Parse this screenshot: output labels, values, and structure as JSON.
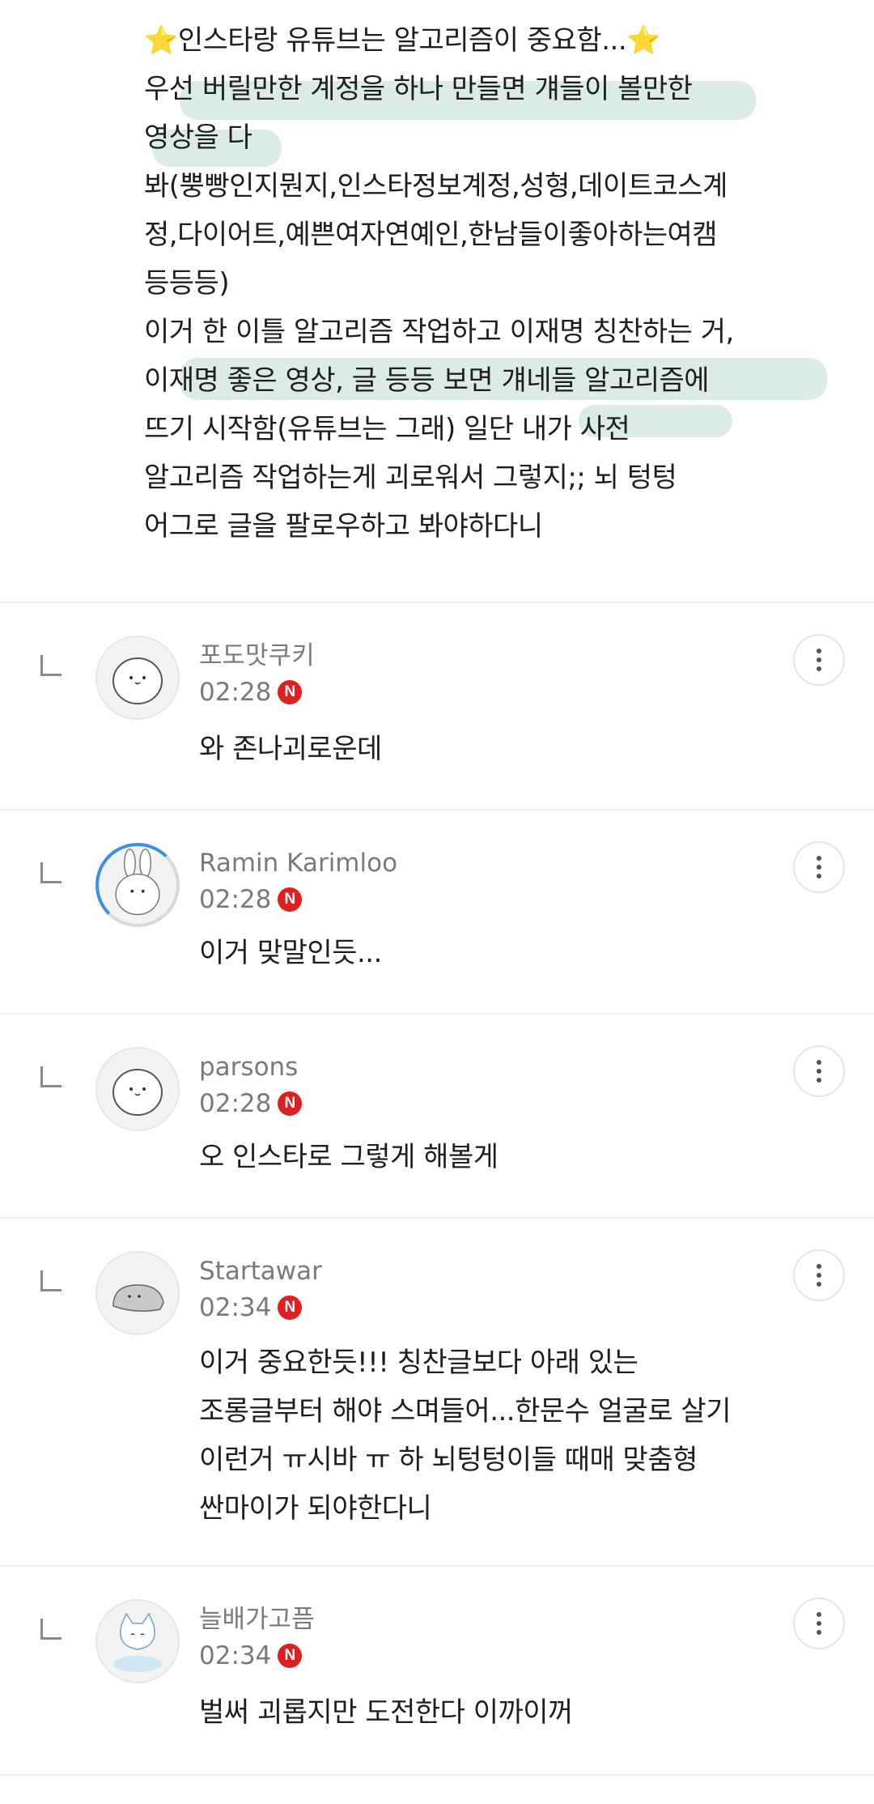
{
  "post": {
    "lines": [
      "⭐인스타랑 유튜브는 알고리즘이 중요함...⭐",
      "우선 버릴만한 계정을 하나 만들면 걔들이 볼만한",
      "영상을 다",
      "봐(뿡빵인지뭔지,인스타정보계정,성형,데이트코스계",
      "정,다이어트,예쁜여자연예인,한남들이좋아하는여캠",
      "등등등)",
      "",
      "이거 한 이틀 알고리즘 작업하고 이재명 칭찬하는 거,",
      "이재명 좋은 영상, 글 등등 보면 걔네들 알고리즘에",
      "뜨기 시작함(유튜브는 그래) 일단 내가 사전",
      "알고리즘 작업하는게 괴로워서 그렇지;; 뇌 텅텅",
      "어그로 글을 팔로우하고 봐야하다니"
    ]
  },
  "comments": [
    {
      "author": "포도맛쿠키",
      "time": "02:28",
      "badge": "N",
      "text": "와 존나괴로운데",
      "avatar_icon": "blob-avatar-icon"
    },
    {
      "author": "Ramin Karimloo",
      "time": "02:28",
      "badge": "N",
      "text": "이거 맞말인듯...",
      "avatar_icon": "bunny-avatar-icon"
    },
    {
      "author": "parsons",
      "time": "02:28",
      "badge": "N",
      "text": "오 인스타로 그렇게 해볼게",
      "avatar_icon": "blob-avatar-icon"
    },
    {
      "author": "Startawar",
      "time": "02:34",
      "badge": "N",
      "text": "이거 중요한듯!!! 칭찬글보다 아래 있는\n조롱글부터 해야 스며들어...한문수 얼굴로 살기\n이런거 ㅠ시바 ㅠ 하 뇌텅텅이들 때매 맞춤형\n싼마이가 되야한다니",
      "avatar_icon": "dino-avatar-icon"
    },
    {
      "author": "늘배가고픔",
      "time": "02:34",
      "badge": "N",
      "text": "벌써 괴롭지만 도전한다 이까이꺼",
      "avatar_icon": "cat-avatar-icon"
    }
  ],
  "colors": {
    "badge": "#e02020",
    "highlight": "#c8e1d7",
    "ring": "#3b8ee8"
  }
}
